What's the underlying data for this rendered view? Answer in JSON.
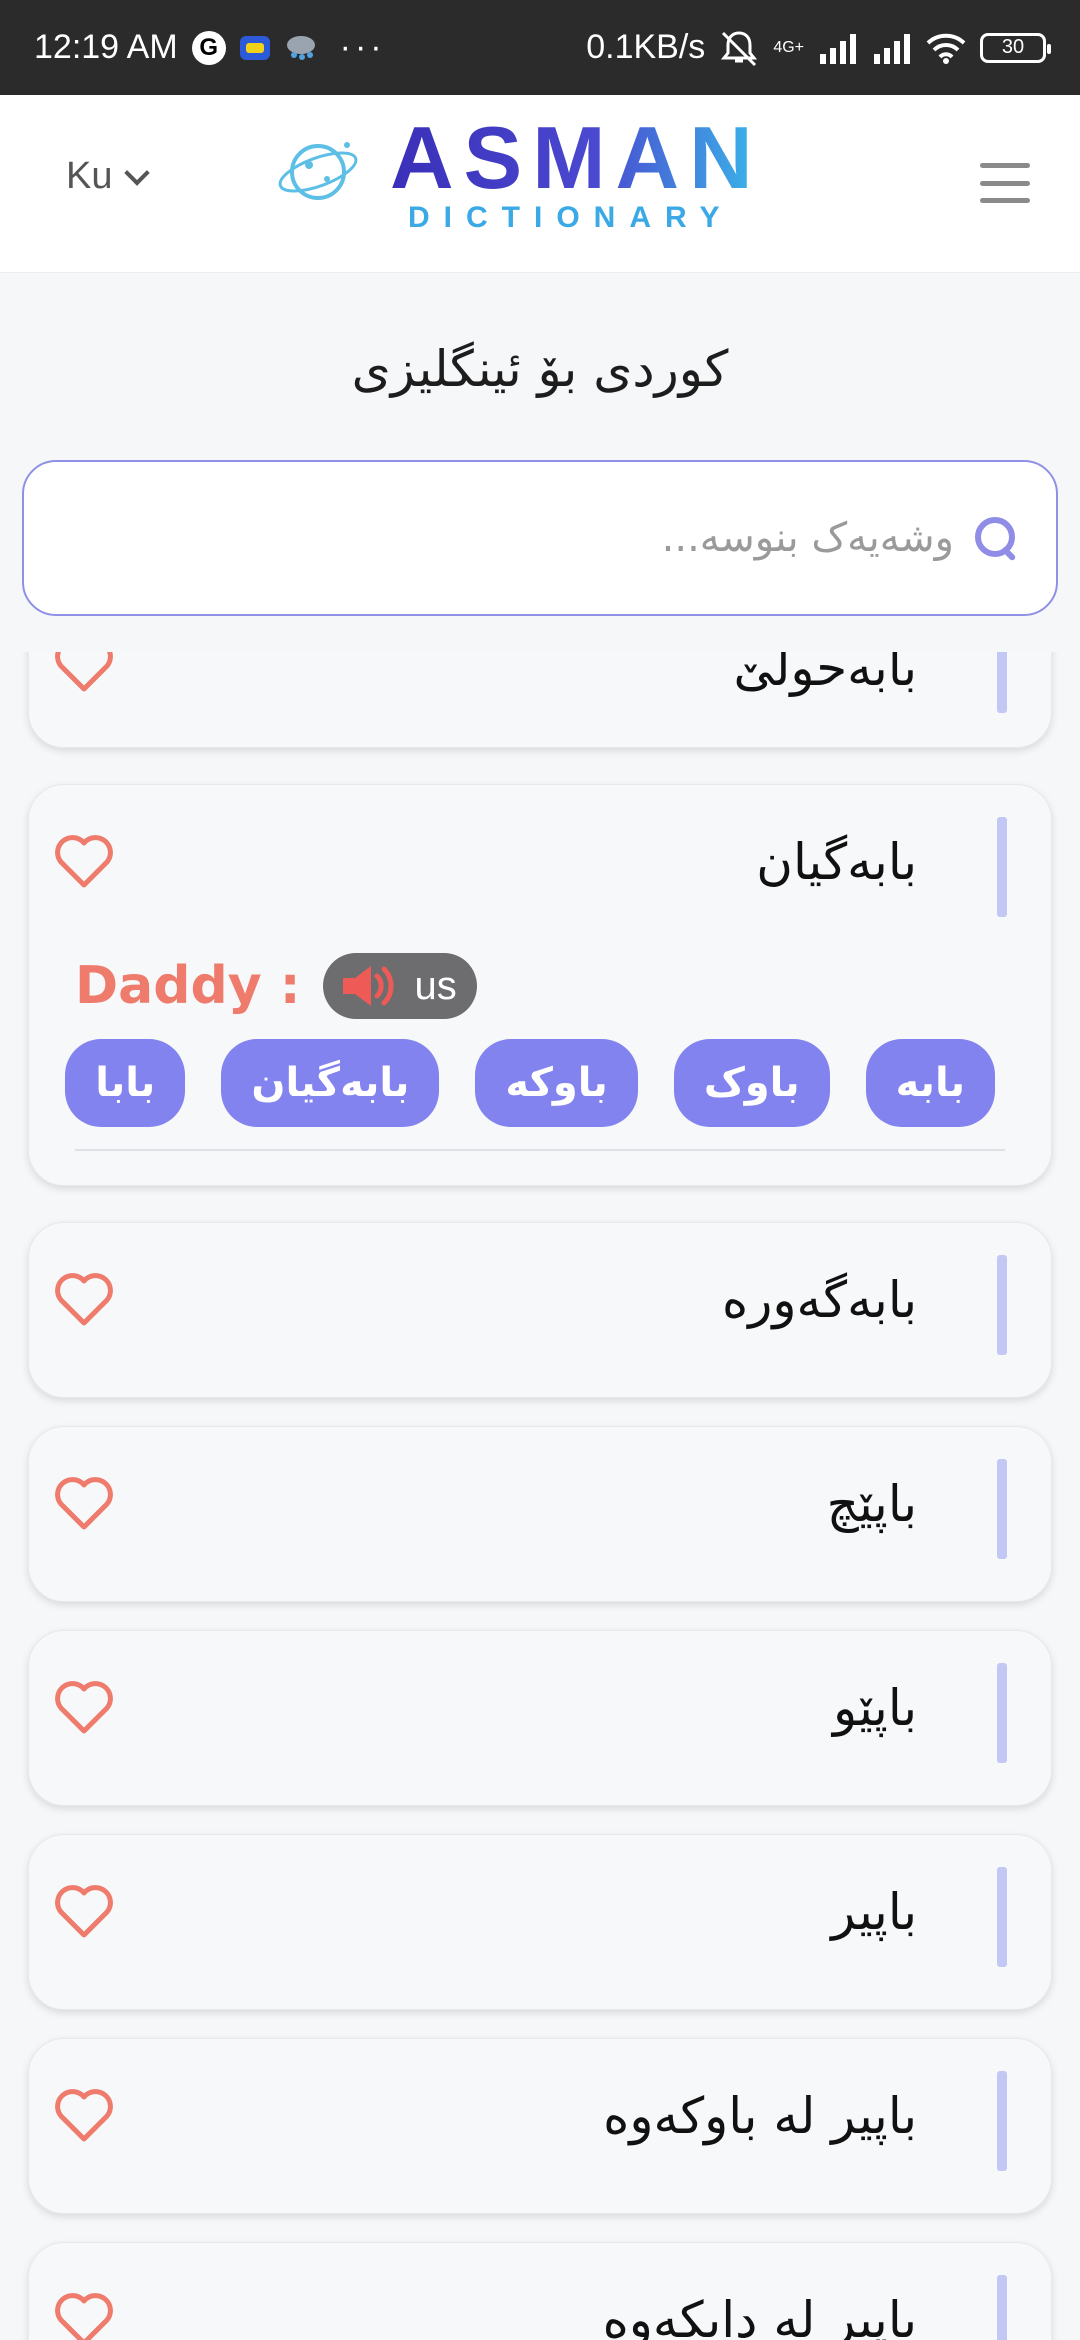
{
  "status_bar": {
    "time": "12:19 AM",
    "g_label": "G",
    "more": "···",
    "speed": "0.1KB/s",
    "net_label": "4G+",
    "battery": "30"
  },
  "header": {
    "lang": "Ku",
    "logo_title": "ASMAN",
    "logo_subtitle": "DICTIONARY"
  },
  "page_title": "کوردی بۆ ئینگلیزی",
  "search": {
    "placeholder": "وشەیەک بنوسە..."
  },
  "colors": {
    "accent": "#8283ef",
    "heart": "#ee7b6b",
    "bar": "#c3c7f4"
  },
  "entries": [
    {
      "word": "بابەحولێ"
    },
    {
      "word": "بابەگیان",
      "translation": "Daddy :",
      "audio_label": "us",
      "related": [
        "بابە",
        "باوک",
        "باوکە",
        "بابەگیان",
        "بابا"
      ]
    },
    {
      "word": "بابەگەورە"
    },
    {
      "word": "باپێچ"
    },
    {
      "word": "باپێو"
    },
    {
      "word": "باپیر"
    },
    {
      "word": "باپیر لە باوکەوە"
    },
    {
      "word": "باپیر لە دایکەوە"
    }
  ]
}
